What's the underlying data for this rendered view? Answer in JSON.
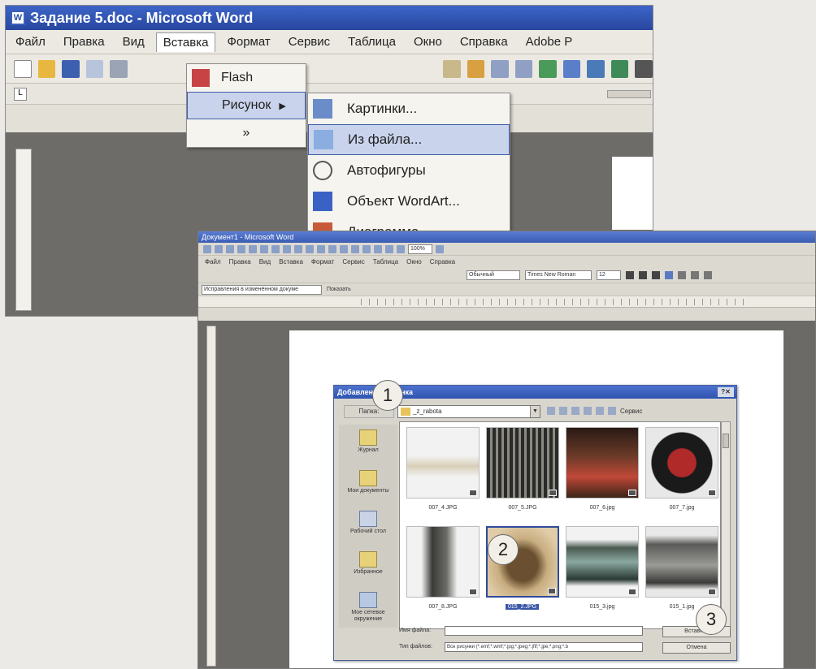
{
  "window_back": {
    "title": "Задание 5.doc - Microsoft Word",
    "menu": [
      "Файл",
      "Правка",
      "Вид",
      "Вставка",
      "Формат",
      "Сервис",
      "Таблица",
      "Окно",
      "Справка",
      "Adobe P"
    ],
    "insert_menu": {
      "items": [
        {
          "label": "Flash",
          "icon": "flash-icon"
        },
        {
          "label": "Рисунок",
          "icon": "none"
        }
      ],
      "more_glyph": "»"
    },
    "picture_submenu": {
      "items": [
        {
          "label": "Картинки...",
          "icon": "clipart-icon"
        },
        {
          "label": "Из файла...",
          "icon": "from-file-icon"
        },
        {
          "label": "Автофигуры",
          "icon": "autoshapes-icon"
        },
        {
          "label": "Объект WordArt...",
          "icon": "wordart-icon"
        },
        {
          "label": "Диаграмма",
          "icon": "chart-icon"
        }
      ]
    },
    "ruler_tab_glyph": "L"
  },
  "window_front": {
    "title": "Документ1 - Microsoft Word",
    "menu": [
      "Файл",
      "Правка",
      "Вид",
      "Вставка",
      "Формат",
      "Сервис",
      "Таблица",
      "Окно",
      "Справка"
    ],
    "zoom": "100%",
    "style": "Обычный",
    "font": "Times New Roman",
    "font_size": "12",
    "review_combo": "Исправления в изменённом докуме",
    "review_show": "Показать"
  },
  "dialog": {
    "title": "Добавление рисунка",
    "look_in_label": "Папка:",
    "look_in_value": "_z_rabota",
    "tools_label": "Сервис",
    "places": [
      {
        "label": "Журнал"
      },
      {
        "label": "Мои документы"
      },
      {
        "label": "Рабочий стол"
      },
      {
        "label": "Избранное"
      },
      {
        "label": "Мое сетевое окружение"
      }
    ],
    "files": [
      {
        "name": "007_4.JPG"
      },
      {
        "name": "007_5.JPG"
      },
      {
        "name": "007_6.jpg"
      },
      {
        "name": "007_7.jpg"
      },
      {
        "name": "007_8.JPG"
      },
      {
        "name": "015_2.JPG"
      },
      {
        "name": "015_3.jpg"
      },
      {
        "name": "015_1.jpg"
      }
    ],
    "filename_label": "Имя файла:",
    "filetype_label": "Тип файлов:",
    "filetype_value": "Все рисунки (*.emf;*.wmf;*.jpg;*.jpeg;*.jfif;*.jpe;*.png;*.b",
    "insert_button": "Вставить",
    "cancel_button": "Отмена"
  },
  "callouts": [
    "1",
    "2",
    "3"
  ]
}
